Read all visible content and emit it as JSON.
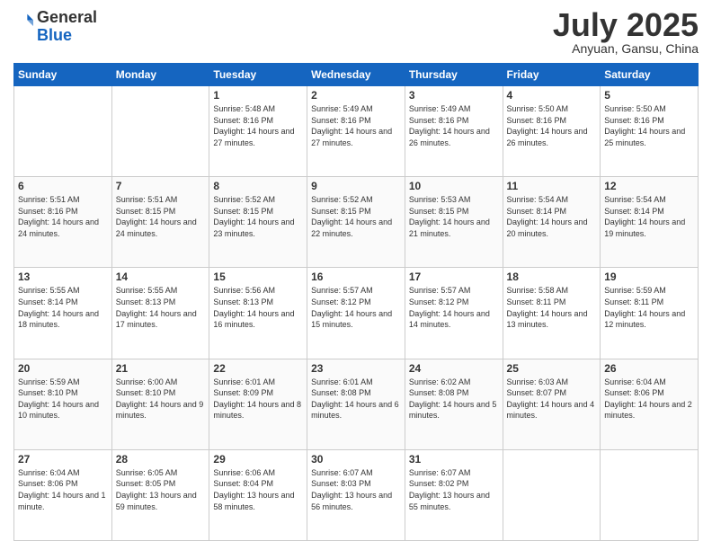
{
  "header": {
    "logo_line1": "General",
    "logo_line2": "Blue",
    "title": "July 2025",
    "location": "Anyuan, Gansu, China"
  },
  "days_of_week": [
    "Sunday",
    "Monday",
    "Tuesday",
    "Wednesday",
    "Thursday",
    "Friday",
    "Saturday"
  ],
  "weeks": [
    [
      {
        "day": "",
        "sunrise": "",
        "sunset": "",
        "daylight": ""
      },
      {
        "day": "",
        "sunrise": "",
        "sunset": "",
        "daylight": ""
      },
      {
        "day": "1",
        "sunrise": "Sunrise: 5:48 AM",
        "sunset": "Sunset: 8:16 PM",
        "daylight": "Daylight: 14 hours and 27 minutes."
      },
      {
        "day": "2",
        "sunrise": "Sunrise: 5:49 AM",
        "sunset": "Sunset: 8:16 PM",
        "daylight": "Daylight: 14 hours and 27 minutes."
      },
      {
        "day": "3",
        "sunrise": "Sunrise: 5:49 AM",
        "sunset": "Sunset: 8:16 PM",
        "daylight": "Daylight: 14 hours and 26 minutes."
      },
      {
        "day": "4",
        "sunrise": "Sunrise: 5:50 AM",
        "sunset": "Sunset: 8:16 PM",
        "daylight": "Daylight: 14 hours and 26 minutes."
      },
      {
        "day": "5",
        "sunrise": "Sunrise: 5:50 AM",
        "sunset": "Sunset: 8:16 PM",
        "daylight": "Daylight: 14 hours and 25 minutes."
      }
    ],
    [
      {
        "day": "6",
        "sunrise": "Sunrise: 5:51 AM",
        "sunset": "Sunset: 8:16 PM",
        "daylight": "Daylight: 14 hours and 24 minutes."
      },
      {
        "day": "7",
        "sunrise": "Sunrise: 5:51 AM",
        "sunset": "Sunset: 8:15 PM",
        "daylight": "Daylight: 14 hours and 24 minutes."
      },
      {
        "day": "8",
        "sunrise": "Sunrise: 5:52 AM",
        "sunset": "Sunset: 8:15 PM",
        "daylight": "Daylight: 14 hours and 23 minutes."
      },
      {
        "day": "9",
        "sunrise": "Sunrise: 5:52 AM",
        "sunset": "Sunset: 8:15 PM",
        "daylight": "Daylight: 14 hours and 22 minutes."
      },
      {
        "day": "10",
        "sunrise": "Sunrise: 5:53 AM",
        "sunset": "Sunset: 8:15 PM",
        "daylight": "Daylight: 14 hours and 21 minutes."
      },
      {
        "day": "11",
        "sunrise": "Sunrise: 5:54 AM",
        "sunset": "Sunset: 8:14 PM",
        "daylight": "Daylight: 14 hours and 20 minutes."
      },
      {
        "day": "12",
        "sunrise": "Sunrise: 5:54 AM",
        "sunset": "Sunset: 8:14 PM",
        "daylight": "Daylight: 14 hours and 19 minutes."
      }
    ],
    [
      {
        "day": "13",
        "sunrise": "Sunrise: 5:55 AM",
        "sunset": "Sunset: 8:14 PM",
        "daylight": "Daylight: 14 hours and 18 minutes."
      },
      {
        "day": "14",
        "sunrise": "Sunrise: 5:55 AM",
        "sunset": "Sunset: 8:13 PM",
        "daylight": "Daylight: 14 hours and 17 minutes."
      },
      {
        "day": "15",
        "sunrise": "Sunrise: 5:56 AM",
        "sunset": "Sunset: 8:13 PM",
        "daylight": "Daylight: 14 hours and 16 minutes."
      },
      {
        "day": "16",
        "sunrise": "Sunrise: 5:57 AM",
        "sunset": "Sunset: 8:12 PM",
        "daylight": "Daylight: 14 hours and 15 minutes."
      },
      {
        "day": "17",
        "sunrise": "Sunrise: 5:57 AM",
        "sunset": "Sunset: 8:12 PM",
        "daylight": "Daylight: 14 hours and 14 minutes."
      },
      {
        "day": "18",
        "sunrise": "Sunrise: 5:58 AM",
        "sunset": "Sunset: 8:11 PM",
        "daylight": "Daylight: 14 hours and 13 minutes."
      },
      {
        "day": "19",
        "sunrise": "Sunrise: 5:59 AM",
        "sunset": "Sunset: 8:11 PM",
        "daylight": "Daylight: 14 hours and 12 minutes."
      }
    ],
    [
      {
        "day": "20",
        "sunrise": "Sunrise: 5:59 AM",
        "sunset": "Sunset: 8:10 PM",
        "daylight": "Daylight: 14 hours and 10 minutes."
      },
      {
        "day": "21",
        "sunrise": "Sunrise: 6:00 AM",
        "sunset": "Sunset: 8:10 PM",
        "daylight": "Daylight: 14 hours and 9 minutes."
      },
      {
        "day": "22",
        "sunrise": "Sunrise: 6:01 AM",
        "sunset": "Sunset: 8:09 PM",
        "daylight": "Daylight: 14 hours and 8 minutes."
      },
      {
        "day": "23",
        "sunrise": "Sunrise: 6:01 AM",
        "sunset": "Sunset: 8:08 PM",
        "daylight": "Daylight: 14 hours and 6 minutes."
      },
      {
        "day": "24",
        "sunrise": "Sunrise: 6:02 AM",
        "sunset": "Sunset: 8:08 PM",
        "daylight": "Daylight: 14 hours and 5 minutes."
      },
      {
        "day": "25",
        "sunrise": "Sunrise: 6:03 AM",
        "sunset": "Sunset: 8:07 PM",
        "daylight": "Daylight: 14 hours and 4 minutes."
      },
      {
        "day": "26",
        "sunrise": "Sunrise: 6:04 AM",
        "sunset": "Sunset: 8:06 PM",
        "daylight": "Daylight: 14 hours and 2 minutes."
      }
    ],
    [
      {
        "day": "27",
        "sunrise": "Sunrise: 6:04 AM",
        "sunset": "Sunset: 8:06 PM",
        "daylight": "Daylight: 14 hours and 1 minute."
      },
      {
        "day": "28",
        "sunrise": "Sunrise: 6:05 AM",
        "sunset": "Sunset: 8:05 PM",
        "daylight": "Daylight: 13 hours and 59 minutes."
      },
      {
        "day": "29",
        "sunrise": "Sunrise: 6:06 AM",
        "sunset": "Sunset: 8:04 PM",
        "daylight": "Daylight: 13 hours and 58 minutes."
      },
      {
        "day": "30",
        "sunrise": "Sunrise: 6:07 AM",
        "sunset": "Sunset: 8:03 PM",
        "daylight": "Daylight: 13 hours and 56 minutes."
      },
      {
        "day": "31",
        "sunrise": "Sunrise: 6:07 AM",
        "sunset": "Sunset: 8:02 PM",
        "daylight": "Daylight: 13 hours and 55 minutes."
      },
      {
        "day": "",
        "sunrise": "",
        "sunset": "",
        "daylight": ""
      },
      {
        "day": "",
        "sunrise": "",
        "sunset": "",
        "daylight": ""
      }
    ]
  ]
}
